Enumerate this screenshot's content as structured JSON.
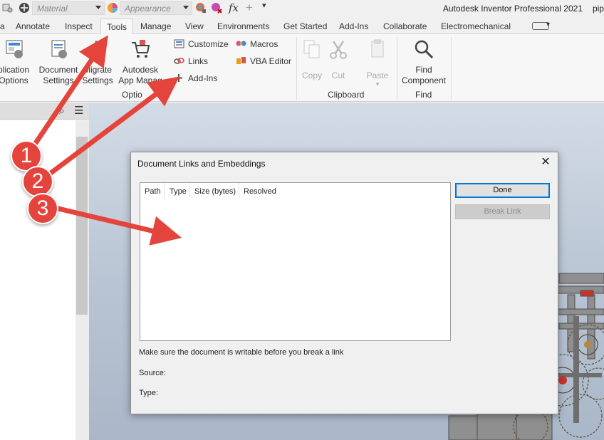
{
  "qat": {
    "material_placeholder": "Material",
    "appearance_placeholder": "Appearance",
    "app_title": "Autodesk Inventor Professional 2021",
    "file_fragment": "pip"
  },
  "tabs": [
    "a",
    "Annotate",
    "Inspect",
    "Tools",
    "Manage",
    "View",
    "Environments",
    "Get Started",
    "Add-Ins",
    "Collaborate",
    "Electromechanical"
  ],
  "active_tab": "Tools",
  "ribbon": {
    "app_options_l1": "plication",
    "app_options_l2": "Options",
    "doc_settings_l1": "Document",
    "doc_settings_l2": "Settings",
    "migrate_l1": "Migrate",
    "migrate_l2": "Settings",
    "autodesk_l1": "Autodesk",
    "autodesk_l2": "App Manag",
    "customize": "Customize",
    "links": "Links",
    "addins": "Add-Ins",
    "macros": "Macros",
    "vba_editor": "VBA Editor",
    "options_group": "Optio",
    "copy": "Copy",
    "cut": "Cut",
    "paste": "Paste",
    "clipboard_group": "Clipboard",
    "find_l1": "Find",
    "find_l2": "Component",
    "find_group": "Find"
  },
  "dialog": {
    "title": "Document Links and Embeddings",
    "close": "✕",
    "columns": [
      "Path",
      "Type",
      "Size (bytes)",
      "Resolved"
    ],
    "done": "Done",
    "break_link": "Break Link",
    "note": "Make sure the document is writable before you break a link",
    "source_label": "Source:",
    "type_label": "Type:"
  },
  "annotations": {
    "colors": {
      "arrow": "#e5443c",
      "badge": "#e5443c"
    },
    "badges": [
      "1",
      "2",
      "3"
    ]
  }
}
